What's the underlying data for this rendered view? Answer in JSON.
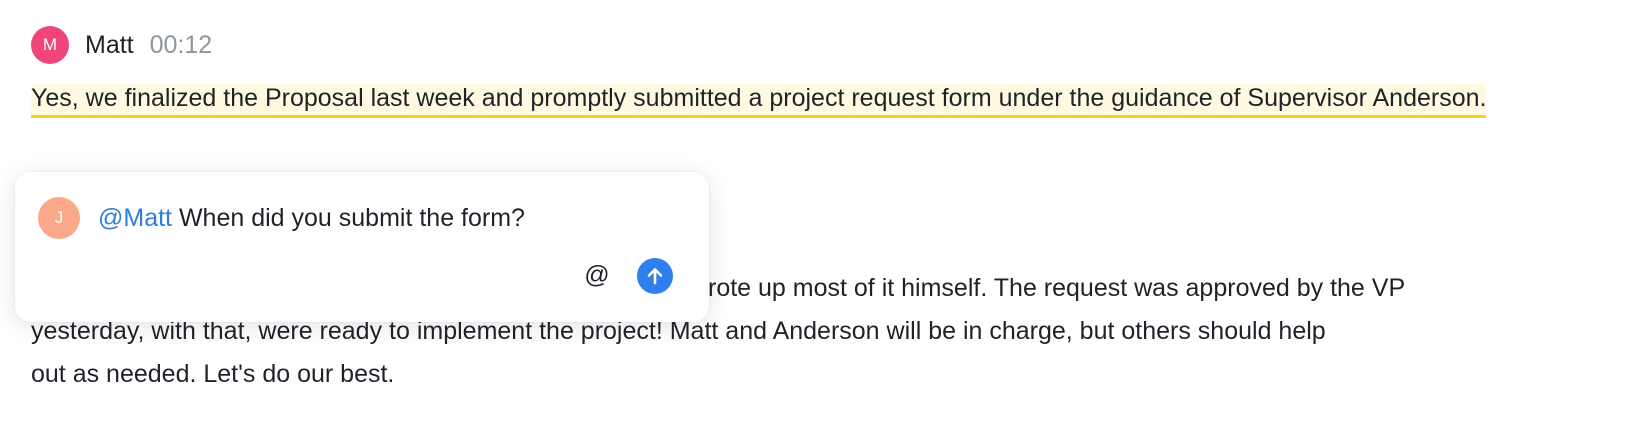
{
  "message": {
    "avatar_letter": "M",
    "author": "Matt",
    "time": "00:12",
    "highlighted_text": "Yes, we finalized the Proposal last week and promptly submitted a project request form under the guidance of Supervisor Anderson.",
    "continued_text_line1": "rote up most of it himself. The request was approved by the VP",
    "continued_text_line2": "yesterday, with that, were ready to implement the project! Matt and Anderson will be in charge, but others should help",
    "continued_text_line3": "out as needed. Let's do our best."
  },
  "comment": {
    "avatar_letter": "J",
    "mention": "@Matt",
    "text": " When did you submit the form?",
    "at_label": "@",
    "send_icon": "arrow-up-icon"
  },
  "colors": {
    "highlight_bg": "#fef9e0",
    "highlight_underline": "#f8d11f",
    "mention": "#2f7ddd",
    "send_button": "#2f80ed",
    "matt_avatar": "#f0457b",
    "commenter_avatar": "#fba78a"
  }
}
